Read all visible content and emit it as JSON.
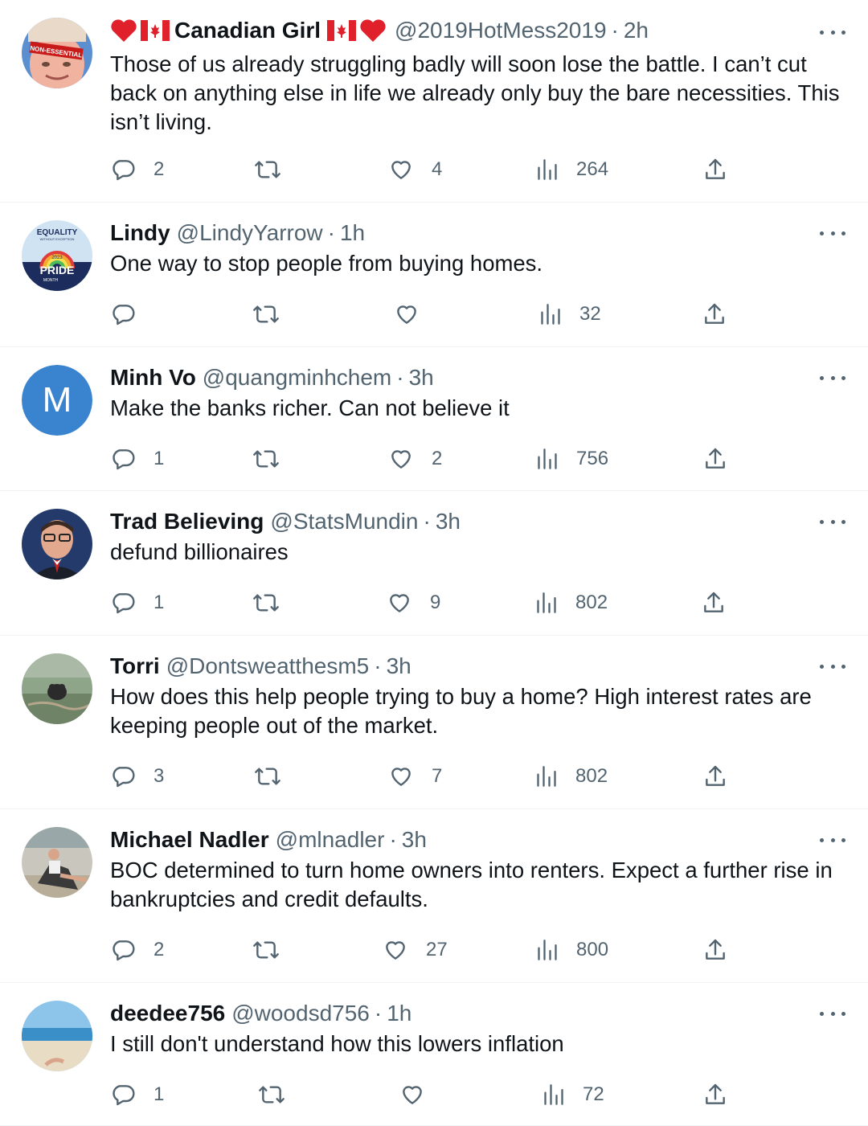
{
  "colors": {
    "text": "#0f1419",
    "secondary": "#536471",
    "divider": "#eff3f4",
    "heart_red": "#e0202b"
  },
  "icons": [
    "reply-icon",
    "retweet-icon",
    "like-icon",
    "views-icon",
    "share-icon",
    "more-icon"
  ],
  "tweets": [
    {
      "name": "Canadian Girl",
      "handle": "@2019HotMess2019",
      "sep": "·",
      "time": "2h",
      "text": "Those of us already struggling badly will soon lose the battle. I can’t cut back on anything else in life  we already only buy the bare necessities. This isn’t living.",
      "replies": "2",
      "retweets": "",
      "likes": "4",
      "views": "264",
      "avatar_text": "NON-ESSENTIAL"
    },
    {
      "name": "Lindy",
      "handle": "@LindyYarrow",
      "sep": "·",
      "time": "1h",
      "text": "One way to stop people from buying homes.",
      "replies": "",
      "retweets": "",
      "likes": "",
      "views": "32",
      "avatar_text_top": "EQUALITY",
      "avatar_text_sub": "WITHOUT EXCEPTION",
      "avatar_text_year": "2023",
      "avatar_text_main": "PRIDE",
      "avatar_text_bottom": "MONTH"
    },
    {
      "name": "Minh Vo",
      "handle": "@quangminhchem",
      "sep": "·",
      "time": "3h",
      "text": "Make the banks richer. Can not believe it",
      "replies": "1",
      "retweets": "",
      "likes": "2",
      "views": "756",
      "avatar_letter": "M"
    },
    {
      "name": "Trad Believing",
      "handle": "@StatsMundin",
      "sep": "·",
      "time": "3h",
      "text": "defund billionaires",
      "replies": "1",
      "retweets": "",
      "likes": "9",
      "views": "802"
    },
    {
      "name": "Torri",
      "handle": "@Dontsweatthesm5",
      "sep": "·",
      "time": "3h",
      "text": "How does this help people trying to buy a home? High interest rates are keeping people out of the market.",
      "replies": "3",
      "retweets": "",
      "likes": "7",
      "views": "802"
    },
    {
      "name": "Michael Nadler",
      "handle": "@mlnadler",
      "sep": "·",
      "time": "3h",
      "text": "BOC determined to turn home owners into renters. Expect a further rise in bankruptcies and credit defaults.",
      "replies": "2",
      "retweets": "",
      "likes": "27",
      "views": "800"
    },
    {
      "name": "deedee756",
      "handle": "@woodsd756",
      "sep": "·",
      "time": "1h",
      "text": "I still don't understand how this lowers inflation",
      "replies": "1",
      "retweets": "",
      "likes": "",
      "views": "72"
    }
  ]
}
